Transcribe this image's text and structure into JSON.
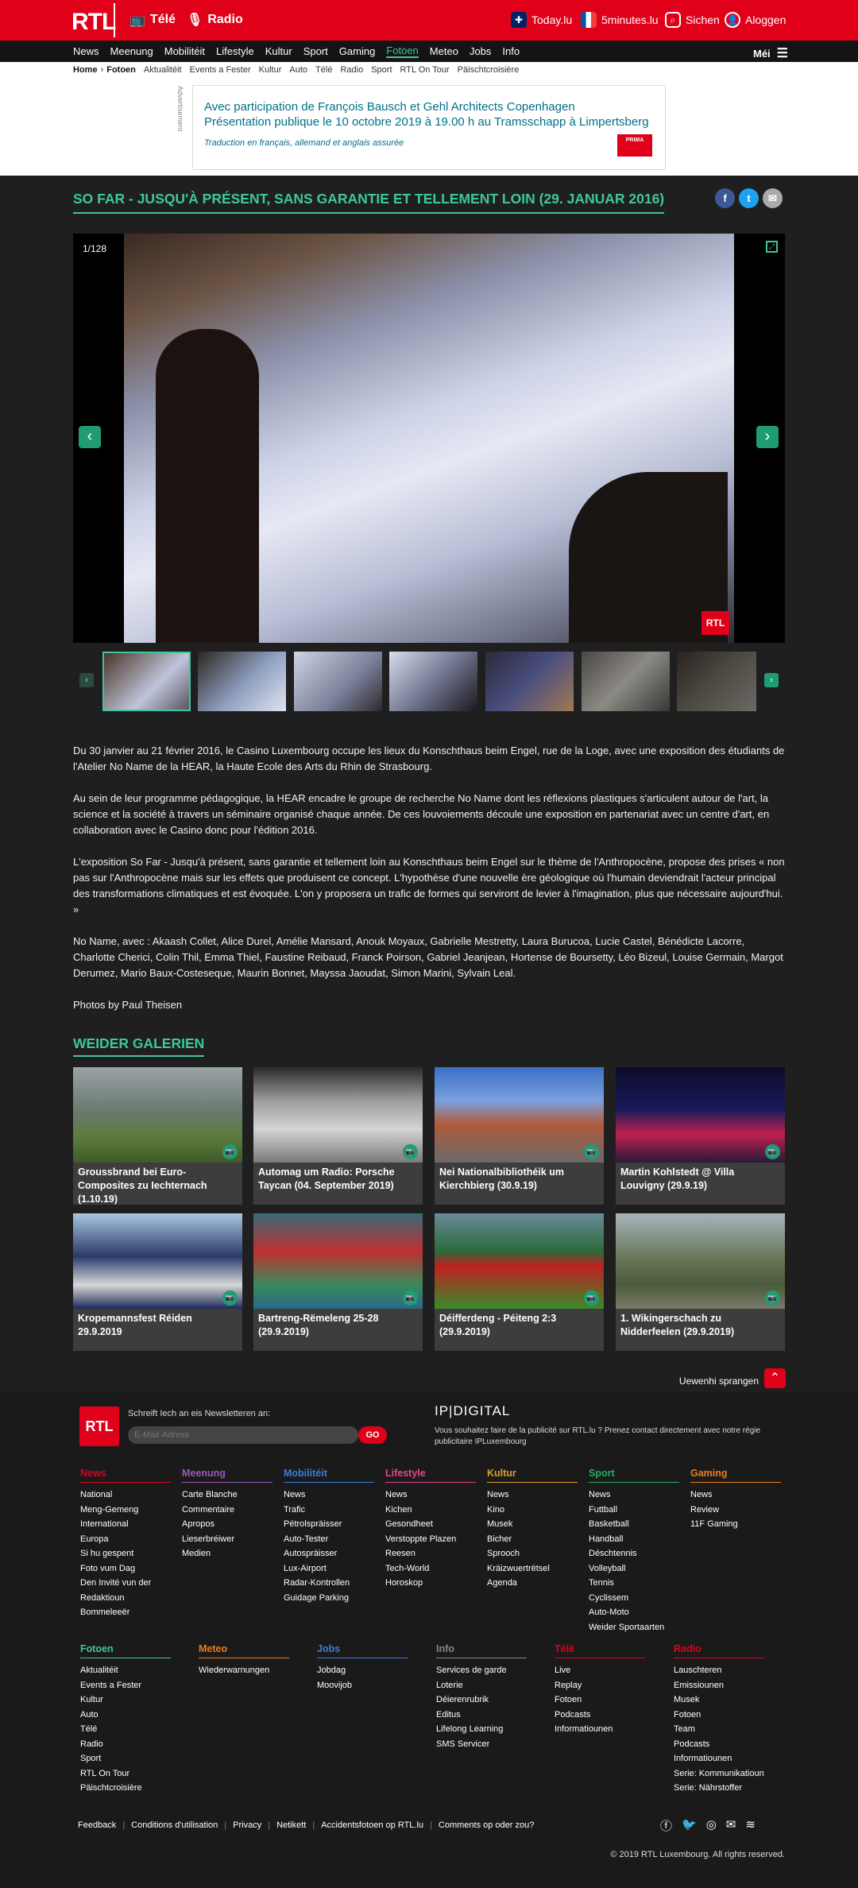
{
  "header": {
    "logo": "RTL",
    "tele": "Télé",
    "radio": "Radio",
    "today": "Today.lu",
    "fiveminutes": "5minutes.lu",
    "search": "Sichen",
    "login": "Aloggen"
  },
  "mainnav": [
    "News",
    "Meenung",
    "Mobilitéit",
    "Lifestyle",
    "Kultur",
    "Sport",
    "Gaming",
    "Fotoen",
    "Meteo",
    "Jobs",
    "Info"
  ],
  "mainnav_active": "Fotoen",
  "mei": "Méi",
  "subnav": {
    "home": "Home",
    "current": "Fotoen",
    "items": [
      "Aktualitéit",
      "Events a Fester",
      "Kultur",
      "Auto",
      "Télé",
      "Radio",
      "Sport",
      "RTL On Tour",
      "Päischtcroisière"
    ]
  },
  "ad": {
    "label": "Advertisement",
    "line1": "Avec participation de François Bausch et Gehl Architects Copenhagen",
    "line2": "Présentation publique le 10 octobre 2019 à 19.00 h au Tramsschapp à Limpertsberg",
    "line3": "Traduction en français, allemand et anglais assurée",
    "logo": "PRIMA"
  },
  "gallery": {
    "title": "SO FAR - JUSQU'À PRÉSENT, SANS GARANTIE ET TELLEMENT LOIN (29. JANUAR 2016)",
    "counter": "1/128",
    "watermark": "RTL"
  },
  "share": {
    "facebook": "f",
    "twitter": "t",
    "mail": "✉"
  },
  "article": {
    "p1": "Du 30 janvier au 21 février 2016, le Casino Luxembourg occupe les lieux du Konschthaus beim Engel, rue de la Loge, avec une exposition des étudiants de l'Atelier No Name de la HEAR, la Haute Ecole des Arts du Rhin de Strasbourg.",
    "p2": "Au sein de leur programme pédagogique, la HEAR encadre le groupe de recherche No Name dont les réflexions plastiques s'articulent autour de l'art, la science et la société à travers un séminaire organisé chaque année. De ces louvoiements découle une exposition en partenariat avec un centre d'art, en collaboration avec le Casino donc pour l'édition 2016.",
    "p3": "L'exposition So Far - Jusqu'à présent, sans garantie et tellement loin au Konschthaus beim Engel sur le thème de l'Anthropocène, propose des prises « non pas sur l'Anthropocène mais sur les effets que produisent ce concept. L'hypothèse d'une nouvelle ère géologique où l'humain deviendrait l'acteur principal des transformations climatiques et est évoquée. L'on y proposera un trafic de formes qui serviront de levier à l'imagination, plus que nécessaire aujourd'hui. »",
    "p4": "No Name, avec : Akaash Collet, Alice Durel, Amélie Mansard, Anouk Moyaux, Gabrielle Mestretty, Laura Burucoa, Lucie Castel, Bénédicte Lacorre, Charlotte Cherici, Colin Thil, Emma Thiel, Faustine Reibaud, Franck Poirson, Gabriel Jeanjean, Hortense de Boursetty, Léo Bizeul, Louise Germain, Margot Derumez, Mario Baux-Costeseque, Maurin Bonnet, Mayssa Jaoudat, Simon Marini, Sylvain Leal.",
    "p5": "Photos by Paul Theisen"
  },
  "more": {
    "title": "WEIDER GALERIEN",
    "cards": [
      {
        "caption": "Groussbrand bei Euro-Composites zu Iechternach (1.10.19)"
      },
      {
        "caption": "Automag um Radio: Porsche Taycan (04. September 2019)"
      },
      {
        "caption": "Nei Nationalbibliothéik um Kierchbierg (30.9.19)"
      },
      {
        "caption": "Martin Kohlstedt @ Villa Louvigny (29.9.19)"
      },
      {
        "caption": "Kropemannsfest Réiden 29.9.2019"
      },
      {
        "caption": "Bartreng-Rëmeleng 25-28 (29.9.2019)"
      },
      {
        "caption": "Déifferdeng - Péiteng 2:3 (29.9.2019)"
      },
      {
        "caption": "1. Wikingerschach zu Nidderfeelen (29.9.2019)"
      }
    ]
  },
  "uewenhi": "Uewenhi sprangen",
  "footer": {
    "logo": "RTL",
    "newsletter_label": "Schreift Iech an eis Newsletteren an:",
    "email_placeholder": "E-Mail-Adress",
    "go": "GO",
    "ip_logo": "IP|DIGITAL",
    "ip_text": "Vous souhaitez faire de la publicité sur RTL.lu ? Prenez contact directement avec notre régie publicitaire IPLuxembourg",
    "cols1": [
      {
        "title": "News",
        "color": "#e0001a",
        "items": [
          "National",
          "Meng-Gemeng",
          "International",
          "Europa",
          "Si hu gespent",
          "Foto vum Dag",
          "Den Invité vun der Redaktioun",
          "Bommeleeër"
        ]
      },
      {
        "title": "Meenung",
        "color": "#9b59b6",
        "items": [
          "Carte Blanche",
          "Commentaire",
          "Apropos",
          "Lieserbréiwer",
          "Medien"
        ]
      },
      {
        "title": "Mobilitéit",
        "color": "#3b7dd8",
        "items": [
          "News",
          "Trafic",
          "Pétrolspräisser",
          "Auto-Tester",
          "Autospräisser",
          "Lux-Airport",
          "Radar-Kontrollen",
          "Guidage Parking"
        ]
      },
      {
        "title": "Lifestyle",
        "color": "#e84393",
        "items": [
          "News",
          "Kichen",
          "Gesondheet",
          "Verstoppte Plazen",
          "Reesen",
          "Tech-World",
          "Horoskop"
        ]
      },
      {
        "title": "Kultur",
        "color": "#e0a02a",
        "items": [
          "News",
          "Kino",
          "Musek",
          "Bicher",
          "Sprooch",
          "Kräizwuertrëtsel",
          "Agenda"
        ]
      },
      {
        "title": "Sport",
        "color": "#27ae60",
        "items": [
          "News",
          "Futtball",
          "Basketball",
          "Handball",
          "Déschtennis",
          "Volleyball",
          "Tennis",
          "Cyclissem",
          "Auto-Moto",
          "Weider Sportaarten"
        ]
      },
      {
        "title": "Gaming",
        "color": "#f07c1a",
        "items": [
          "News",
          "Review",
          "11F Gaming"
        ]
      }
    ],
    "cols2": [
      {
        "title": "Fotoen",
        "color": "#3ec79e",
        "items": [
          "Aktualitéit",
          "Events a Fester",
          "Kultur",
          "Auto",
          "Télé",
          "Radio",
          "Sport",
          "RTL On Tour",
          "Päischtcroisière"
        ]
      },
      {
        "title": "Meteo",
        "color": "#f07c1a",
        "items": [
          "Wiederwarnungen"
        ]
      },
      {
        "title": "Jobs",
        "color": "#3b7dd8",
        "items": [
          "Jobdag",
          "Moovijob"
        ]
      },
      {
        "title": "Info",
        "color": "#888888",
        "items": [
          "Services de garde",
          "Loterie",
          "Déierenrubrik",
          "Editus",
          "Lifelong Learning",
          "SMS Servicer"
        ]
      },
      {
        "title": "Télé",
        "color": "#e0001a",
        "items": [
          "Live",
          "Replay",
          "Fotoen",
          "Podcasts",
          "Informatiounen"
        ]
      },
      {
        "title": "Radio",
        "color": "#e0001a",
        "items": [
          "Lauschteren",
          "Emissiounen",
          "Musek",
          "Fotoen",
          "Team",
          "Podcasts",
          "Informatiounen",
          "Serie: Kommunikatioun",
          "Serie: Nährstoffer"
        ]
      }
    ],
    "bottom_links": [
      "Feedback",
      "Conditions d'utilisation",
      "Privacy",
      "Netikett",
      "Accidentsfotoen op RTL.lu",
      "Comments op oder zou?"
    ],
    "copyright": "© 2019 RTL Luxembourg. All rights reserved."
  },
  "colors": {
    "brand_red": "#e0001a",
    "accent_green": "#3ec79e"
  }
}
